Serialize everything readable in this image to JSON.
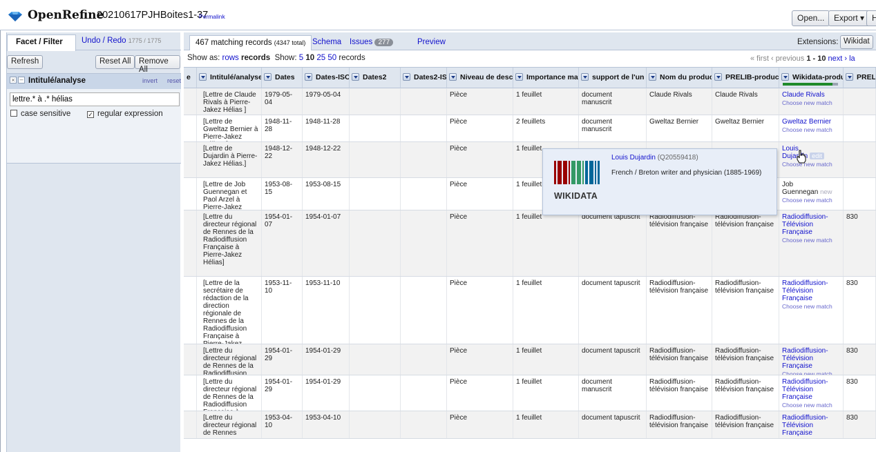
{
  "header": {
    "app_name": "OpenRefine",
    "project_name": "20210617PJHBoites1-37",
    "permalink": "Permalink",
    "open_label": "Open...",
    "export_label": "Export ▾",
    "help_label": "H"
  },
  "left_panel": {
    "tab_facet": "Facet / Filter",
    "tab_undo": "Undo / Redo",
    "tab_undo_count": "1775 / 1775",
    "refresh": "Refresh",
    "reset_all": "Reset All",
    "remove_all": "Remove All",
    "facet": {
      "close": "×",
      "minimize": "–",
      "title": "Intitulé/analyse",
      "invert": "invert",
      "reset": "reset",
      "value": "lettre.* à .* hélias",
      "case_sensitive": "case sensitive",
      "regular_expression": "regular expression",
      "case_checked": false,
      "regex_checked": true
    }
  },
  "view": {
    "records_tab": "467 matching records",
    "records_total": "(4347 total)",
    "schema": "Schema",
    "issues": "Issues",
    "issues_count": "277",
    "preview": "Preview",
    "extensions_label": "Extensions:",
    "extensions_btn": "Wikidat"
  },
  "show_bar": {
    "show_as": "Show as:",
    "rows": "rows",
    "records": "records",
    "show": "Show:",
    "n5": "5",
    "n10": "10",
    "n25": "25",
    "n50": "50",
    "suffix": "records",
    "first": "« first",
    "previous": "‹ previous",
    "range": "1 - 10",
    "next": "next ›",
    "last": "la"
  },
  "columns": [
    {
      "label": "e"
    },
    {
      "label": "Intitulé/analyse"
    },
    {
      "label": "Dates"
    },
    {
      "label": "Dates-ISO"
    },
    {
      "label": "Dates2"
    },
    {
      "label": "Dates2-ISO"
    },
    {
      "label": "Niveau de descr"
    },
    {
      "label": "Importance mat"
    },
    {
      "label": "support de l'un"
    },
    {
      "label": "Nom du produc"
    },
    {
      "label": "PRELIB-product"
    },
    {
      "label": "Wikidata-produ"
    },
    {
      "label": "PREL"
    }
  ],
  "reconcile_progress": 0.9,
  "rows": [
    {
      "intitule": "[Lettre de Claude Rivals à Pierre-Jakez Hélias ]",
      "dates": "1979-05-04",
      "iso": "1979-05-04",
      "niveau": "Pièce",
      "importance": "1 feuillet",
      "support": "document manuscrit",
      "nom": "Claude Rivals",
      "prelib": "Claude Rivals",
      "wd": "Claude Rivals",
      "wd_sub": "Choose new match",
      "prel": ""
    },
    {
      "intitule": "[Lettre de Gweltaz Bernier à Pierre-Jakez Hélias. ]",
      "dates": "1948-11-28",
      "iso": "1948-11-28",
      "niveau": "Pièce",
      "importance": "2 feuillets",
      "support": "document manuscrit",
      "nom": "Gweltaz Bernier",
      "prelib": "Gweltaz Bernier",
      "wd": "Gweltaz Bernier",
      "wd_sub": "Choose new match",
      "prel": ""
    },
    {
      "intitule": "[Lettre de Dujardin à Pierre-Jakez Hélias.]",
      "dates": "1948-12-22",
      "iso": "1948-12-22",
      "niveau": "Pièce",
      "importance": "1 feuillet",
      "support": "",
      "nom": "",
      "prelib": "",
      "wd": "Louis Dujardin",
      "wd_edit": "edit",
      "wd_sub": "Choose new match",
      "prel": ""
    },
    {
      "intitule": "[Lettre de Job Guennegan et Paol Arzel à Pierre-Jakez Hélias]",
      "dates": "1953-08-15",
      "iso": "1953-08-15",
      "niveau": "Pièce",
      "importance": "1 feuillet",
      "support": "",
      "nom": "",
      "prelib": "",
      "wd": "Job",
      "wd2": "Guennegan",
      "wd_new": "new",
      "wd_sub": "Choose new match",
      "prel": ""
    },
    {
      "intitule": "[Lettre du directeur régional de Rennes de la Radiodiffusion Française à Pierre-Jakez Hélias]",
      "dates": "1954-01-07",
      "iso": "1954-01-07",
      "niveau": "Pièce",
      "importance": "1 feuillet",
      "support": "document tapuscrit",
      "nom": "Radiodiffusion-télévision française",
      "prelib": "Radiodiffusion-télévision française",
      "wd": "Radiodiffusion-Télévision Française",
      "wd_sub": "Choose new match",
      "prel": "830"
    },
    {
      "intitule": "[Lettre de la secrétaire de rédaction de la direction régionale de Rennes de la Radiodiffusion Française à Pierre-Jakez Hélias]",
      "dates": "1953-11-10",
      "iso": "1953-11-10",
      "niveau": "Pièce",
      "importance": "1 feuillet",
      "support": "document tapuscrit",
      "nom": "Radiodiffusion-télévision française",
      "prelib": "Radiodiffusion-télévision française",
      "wd": "Radiodiffusion-Télévision Française",
      "wd_sub": "Choose new match",
      "prel": "830"
    },
    {
      "intitule": "[Lettre du directeur régional de Rennes de la Radiodiffusion Française à Pierre-Jakez Hélias]",
      "dates": "1954-01-29",
      "iso": "1954-01-29",
      "niveau": "Pièce",
      "importance": "1 feuillet",
      "support": "document tapuscrit",
      "nom": "Radiodiffusion-télévision française",
      "prelib": "Radiodiffusion-télévision française",
      "wd": "Radiodiffusion-Télévision Française",
      "wd_sub": "Choose new match",
      "prel": "830"
    },
    {
      "intitule": "[Lettre du directeur régional de Rennes de la Radiodiffusion Française à Pierre-Jakez Hélias ]",
      "dates": "1954-01-29",
      "iso": "1954-01-29",
      "niveau": "Pièce",
      "importance": "1 feuillet",
      "support": "document manuscrit",
      "nom": "Radiodiffusion-télévision française",
      "prelib": "Radiodiffusion-télévision française",
      "wd": "Radiodiffusion-Télévision Française",
      "wd_sub": "Choose new match",
      "prel": "830"
    },
    {
      "intitule": "[Lettre du directeur régional de Rennes",
      "dates": "1953-04-10",
      "iso": "1953-04-10",
      "niveau": "Pièce",
      "importance": "1 feuillet",
      "support": "document tapuscrit",
      "nom": "Radiodiffusion-télévision française",
      "prelib": "Radiodiffusion-télévision française",
      "wd": "Radiodiffusion-Télévision Française",
      "wd_sub": "",
      "prel": "830"
    }
  ],
  "popup": {
    "name": "Louis Dujardin",
    "qid": "(Q20559418)",
    "description": "French / Breton writer and physician (1885-1969)",
    "logo_text": "WIKIDATA"
  },
  "colors": {
    "accent_blue": "#1111cc",
    "panel_bg": "#dfe6ef",
    "progress_green": "#1f8a2a",
    "progress_gray": "#9aa4b2",
    "logo_blue": "#2a6fd6"
  }
}
